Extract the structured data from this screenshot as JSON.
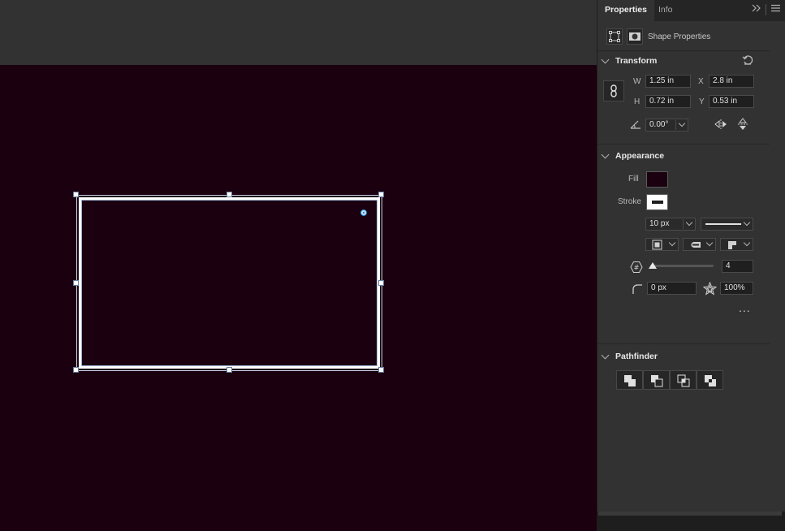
{
  "panel": {
    "tabs": [
      {
        "label": "Properties"
      },
      {
        "label": "Info"
      }
    ],
    "expand_icon": "double-chevron-right-icon",
    "menu_icon": "hamburger-menu-icon",
    "shape_properties_label": "Shape Properties"
  },
  "transform": {
    "title": "Transform",
    "w_label": "W",
    "w_value": "1.25 in",
    "h_label": "H",
    "h_value": "0.72 in",
    "x_label": "X",
    "x_value": "2.8 in",
    "y_label": "Y",
    "y_value": "0.53 in",
    "angle_value": "0.00°"
  },
  "appearance": {
    "title": "Appearance",
    "fill_label": "Fill",
    "stroke_label": "Stroke",
    "fill_color": "#1b0010",
    "stroke_color": "#ffffff",
    "stroke_width": "10 px",
    "sides_value": "4",
    "corner_radius": "0 px",
    "star_ratio": "100%",
    "more": "..."
  },
  "pathfinder": {
    "title": "Pathfinder"
  },
  "colors": {
    "artboard": "#1b0010",
    "panel_bg": "#323232",
    "selection": "#c6d2e8"
  }
}
